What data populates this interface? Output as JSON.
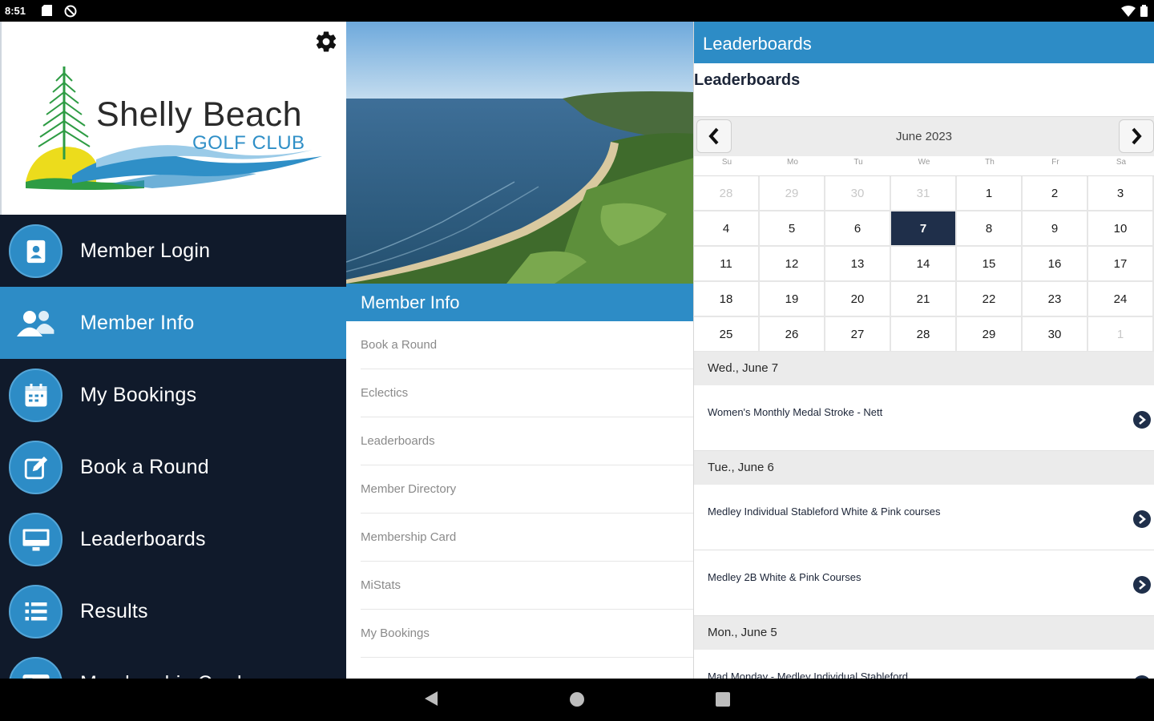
{
  "status_bar": {
    "time": "8:51"
  },
  "brand": {
    "title": "Shelly Beach",
    "subtitle": "GOLF CLUB"
  },
  "sidebar": {
    "items": [
      {
        "label": "Member Login",
        "icon": "id-badge-icon",
        "active": false
      },
      {
        "label": "Member Info",
        "icon": "users-icon",
        "active": true
      },
      {
        "label": "My Bookings",
        "icon": "calendar-icon",
        "active": false
      },
      {
        "label": "Book a Round",
        "icon": "edit-icon",
        "active": false
      },
      {
        "label": "Leaderboards",
        "icon": "monitor-icon",
        "active": false
      },
      {
        "label": "Results",
        "icon": "list-icon",
        "active": false
      },
      {
        "label": "Membership Card",
        "icon": "card-icon",
        "active": false
      }
    ]
  },
  "member_info": {
    "header": "Member Info",
    "items": [
      "Book a Round",
      "Eclectics",
      "Leaderboards",
      "Member Directory",
      "Membership Card",
      "MiStats",
      "My Bookings"
    ]
  },
  "leaderboards": {
    "header": "Leaderboards",
    "subtitle": "Leaderboards",
    "calendar": {
      "month": "June 2023",
      "weekdays": [
        "Su",
        "Mo",
        "Tu",
        "We",
        "Th",
        "Fr",
        "Sa"
      ],
      "days": [
        {
          "d": "28",
          "muted": true
        },
        {
          "d": "29",
          "muted": true
        },
        {
          "d": "30",
          "muted": true
        },
        {
          "d": "31",
          "muted": true
        },
        {
          "d": "1"
        },
        {
          "d": "2"
        },
        {
          "d": "3"
        },
        {
          "d": "4"
        },
        {
          "d": "5"
        },
        {
          "d": "6"
        },
        {
          "d": "7",
          "selected": true
        },
        {
          "d": "8"
        },
        {
          "d": "9"
        },
        {
          "d": "10"
        },
        {
          "d": "11"
        },
        {
          "d": "12"
        },
        {
          "d": "13"
        },
        {
          "d": "14"
        },
        {
          "d": "15"
        },
        {
          "d": "16"
        },
        {
          "d": "17"
        },
        {
          "d": "18"
        },
        {
          "d": "19"
        },
        {
          "d": "20"
        },
        {
          "d": "21"
        },
        {
          "d": "22"
        },
        {
          "d": "23"
        },
        {
          "d": "24"
        },
        {
          "d": "25"
        },
        {
          "d": "26"
        },
        {
          "d": "27"
        },
        {
          "d": "28"
        },
        {
          "d": "29"
        },
        {
          "d": "30"
        },
        {
          "d": "1",
          "muted": true
        }
      ]
    },
    "events": [
      {
        "date": "Wed., June 7",
        "items": [
          "Women's Monthly Medal Stroke - Nett"
        ]
      },
      {
        "date": "Tue., June 6",
        "items": [
          "Medley Individual Stableford White & Pink courses",
          "Medley 2B White & Pink Courses"
        ]
      },
      {
        "date": "Mon., June 5",
        "items": [
          "Mad Monday - Medley Individual Stableford"
        ]
      }
    ]
  },
  "colors": {
    "accent": "#2d8cc6",
    "navy": "#101a2b",
    "selected_day": "#1f2f4a"
  }
}
